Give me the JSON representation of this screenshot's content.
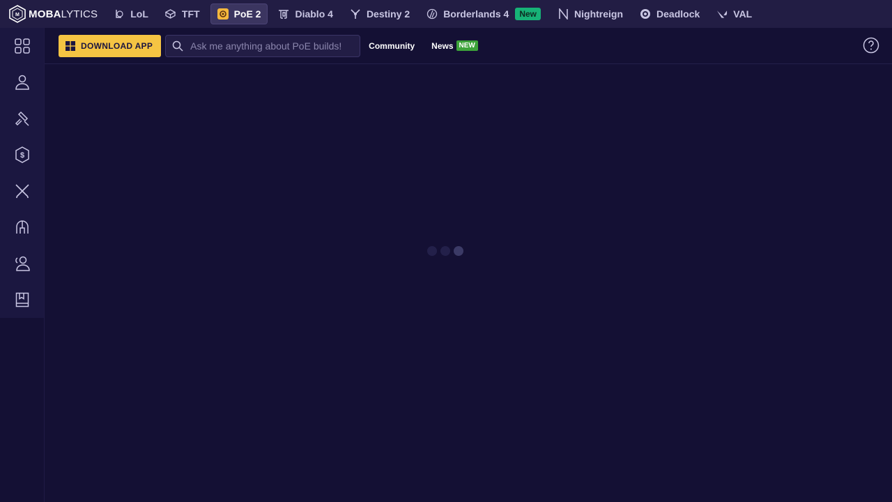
{
  "logo": {
    "bold": "MOBA",
    "light": "LYTICS"
  },
  "games": [
    {
      "label": "LoL",
      "icon": "lol-icon"
    },
    {
      "label": "TFT",
      "icon": "tft-icon"
    },
    {
      "label": "PoE 2",
      "icon": "poe2-icon",
      "active": true
    },
    {
      "label": "Diablo 4",
      "icon": "diablo-icon"
    },
    {
      "label": "Destiny 2",
      "icon": "destiny-icon"
    },
    {
      "label": "Borderlands 4",
      "icon": "borderlands-icon",
      "badge": "New"
    },
    {
      "label": "Nightreign",
      "icon": "nightreign-icon"
    },
    {
      "label": "Deadlock",
      "icon": "deadlock-icon"
    },
    {
      "label": "VAL",
      "icon": "valorant-icon"
    }
  ],
  "sidebar": {
    "items": [
      {
        "icon": "grid-icon"
      },
      {
        "icon": "profile-icon"
      },
      {
        "icon": "builds-hammer-icon"
      },
      {
        "icon": "currency-icon"
      },
      {
        "icon": "crossed-swords-icon"
      },
      {
        "icon": "helmet-icon"
      },
      {
        "icon": "community-icon"
      },
      {
        "icon": "guides-book-icon"
      }
    ]
  },
  "subbar": {
    "download_label": "DOWNLOAD APP",
    "search_placeholder": "Ask me anything about PoE builds!",
    "community_label": "Community",
    "news_label": "News",
    "news_badge": "NEW"
  },
  "colors": {
    "background": "#141034",
    "topbar": "#221d44",
    "accent_yellow": "#f5c443",
    "badge_green": "#17b277",
    "news_green": "#3da33a"
  }
}
